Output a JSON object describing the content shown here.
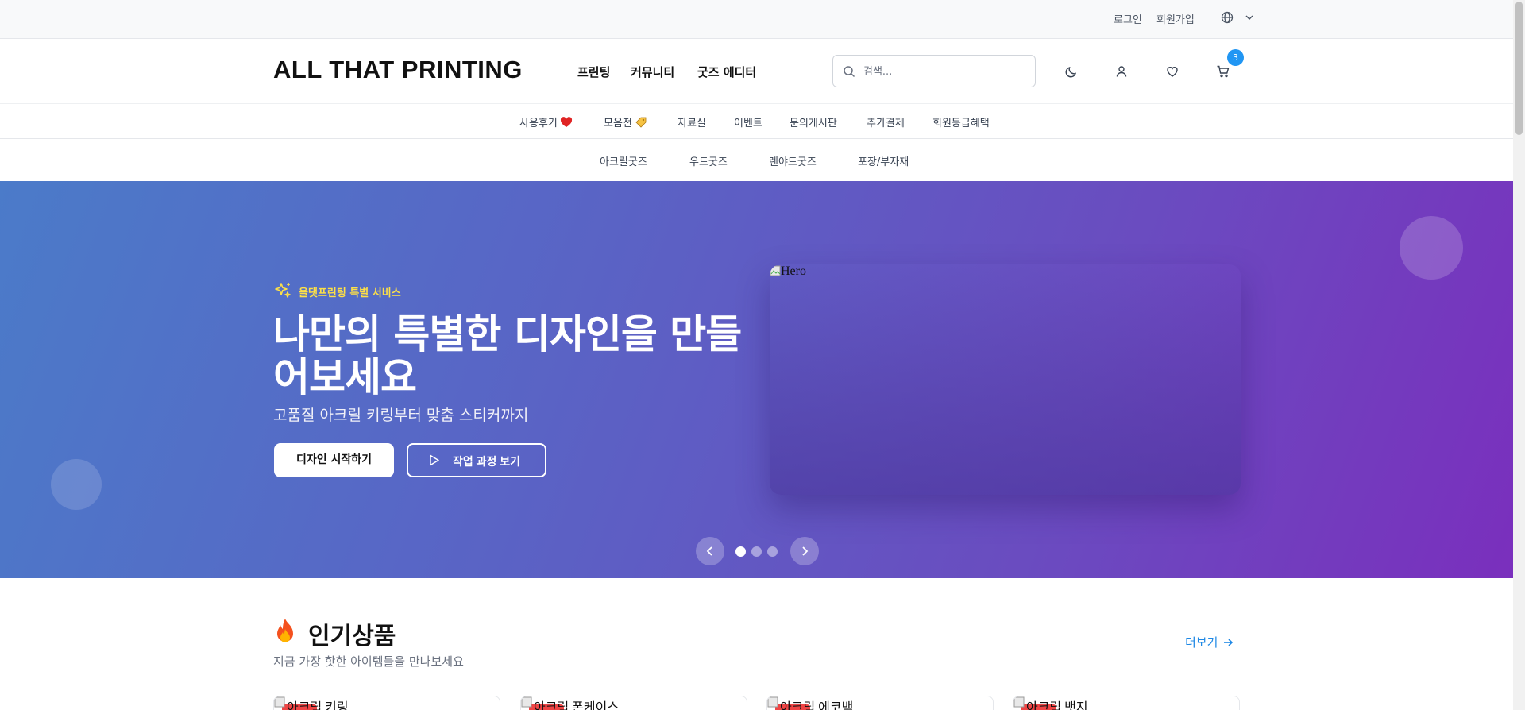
{
  "utility_bar": {
    "login": "로그인",
    "signup": "회원가입",
    "language_icon": "globe-icon",
    "dropdown_icon": "chevron-down-icon"
  },
  "header": {
    "logo": "ALL THAT PRINTING",
    "nav": [
      "프린팅",
      "커뮤니티",
      "굿즈 에디터"
    ],
    "search": {
      "placeholder": "검색...",
      "value": ""
    },
    "icons": [
      "moon-icon",
      "user-icon",
      "heart-icon",
      "cart-icon"
    ],
    "cart_count": "3"
  },
  "subnav": {
    "items": [
      {
        "label": "사용후기",
        "emoji": "heart"
      },
      {
        "label": "모음전",
        "emoji": "tag"
      },
      {
        "label": "자료실"
      },
      {
        "label": "이벤트"
      },
      {
        "label": "문의게시판"
      },
      {
        "label": "추가결제"
      },
      {
        "label": "회원등급혜택"
      }
    ]
  },
  "categories": [
    "아크릴굿즈",
    "우드굿즈",
    "렌야드굿즈",
    "포장/부자재"
  ],
  "hero": {
    "badge": "올댓프린팅 특별 서비스",
    "title": "나만의 특별한 디자인을 만들어보세요",
    "subtitle": "고품질 아크릴 키링부터 맞춤 스티커까지",
    "primary_button": "디자인 시작하기",
    "secondary_button": "작업 과정 보기",
    "image_alt": "Hero",
    "slides": 3,
    "active_slide": 1
  },
  "popular": {
    "title": "인기상품",
    "subtitle": "지금 가장 핫한 아이템들을 만나보세요",
    "more": "더보기",
    "products": [
      "아크릴 키링",
      "아크릴 폰케이스",
      "아크릴 에코백",
      "아크릴 뱃지"
    ]
  },
  "colors": {
    "accent": "#2196f3",
    "badge_text": "#fde047",
    "hero_gradient_start": "#4b7bc9",
    "hero_gradient_end": "#7a2fbd",
    "link": "#1e88e5",
    "new_badge": "#ef4444"
  }
}
